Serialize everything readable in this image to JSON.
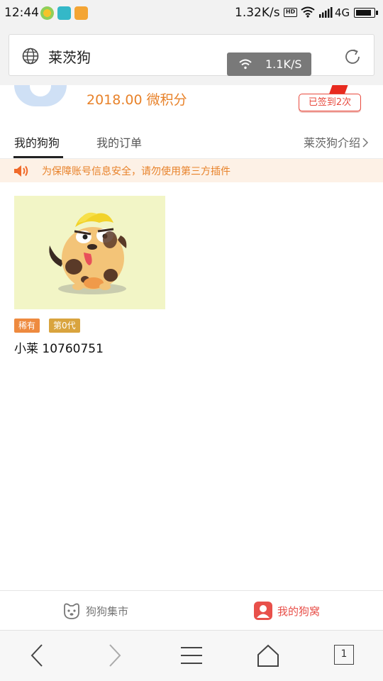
{
  "status_bar": {
    "time": "12:44",
    "net_speed": "1.32K/s",
    "hd_label": "HD",
    "network": "4G",
    "battery_level": 0.9
  },
  "url_bar": {
    "title": "莱茨狗",
    "toast_speed": "1.1K/S"
  },
  "profile": {
    "points": "2018.00 微积分",
    "checkin_label": "已签到2次"
  },
  "tabs": {
    "my_dogs": "我的狗狗",
    "my_orders": "我的订单",
    "intro": "莱茨狗介绍"
  },
  "notice": {
    "text": "为保障账号信息安全，请勿使用第三方插件"
  },
  "dog": {
    "rarity": "稀有",
    "generation": "第0代",
    "name": "小莱 10760751"
  },
  "app_nav": {
    "market": "狗狗集市",
    "mine": "我的狗窝"
  },
  "browser_bar": {
    "tab_count": "1"
  },
  "colors": {
    "accent_orange": "#e8822a",
    "accent_red": "#e8504a",
    "notice_bg": "#fdf1e6",
    "dog_bg": "#f2f5c6"
  }
}
